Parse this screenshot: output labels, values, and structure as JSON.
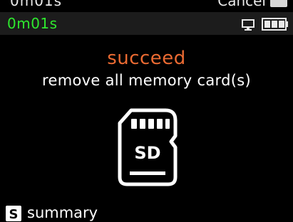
{
  "top_strip": {
    "prev_time": "0m01s",
    "prev_cancel": "Cancel"
  },
  "status_bar": {
    "timer": "0m01s",
    "timer_color": "#2ee82e",
    "icons": [
      "monitor-icon",
      "battery-icon"
    ]
  },
  "main": {
    "status_title": "succeed",
    "status_title_color": "#ea6a32",
    "message": "remove all memory card(s)",
    "card_icon": "sd-card-icon",
    "card_label": "SD"
  },
  "footer": {
    "key_icon": "s-key-icon",
    "key_letter": "S",
    "label": "summary"
  }
}
